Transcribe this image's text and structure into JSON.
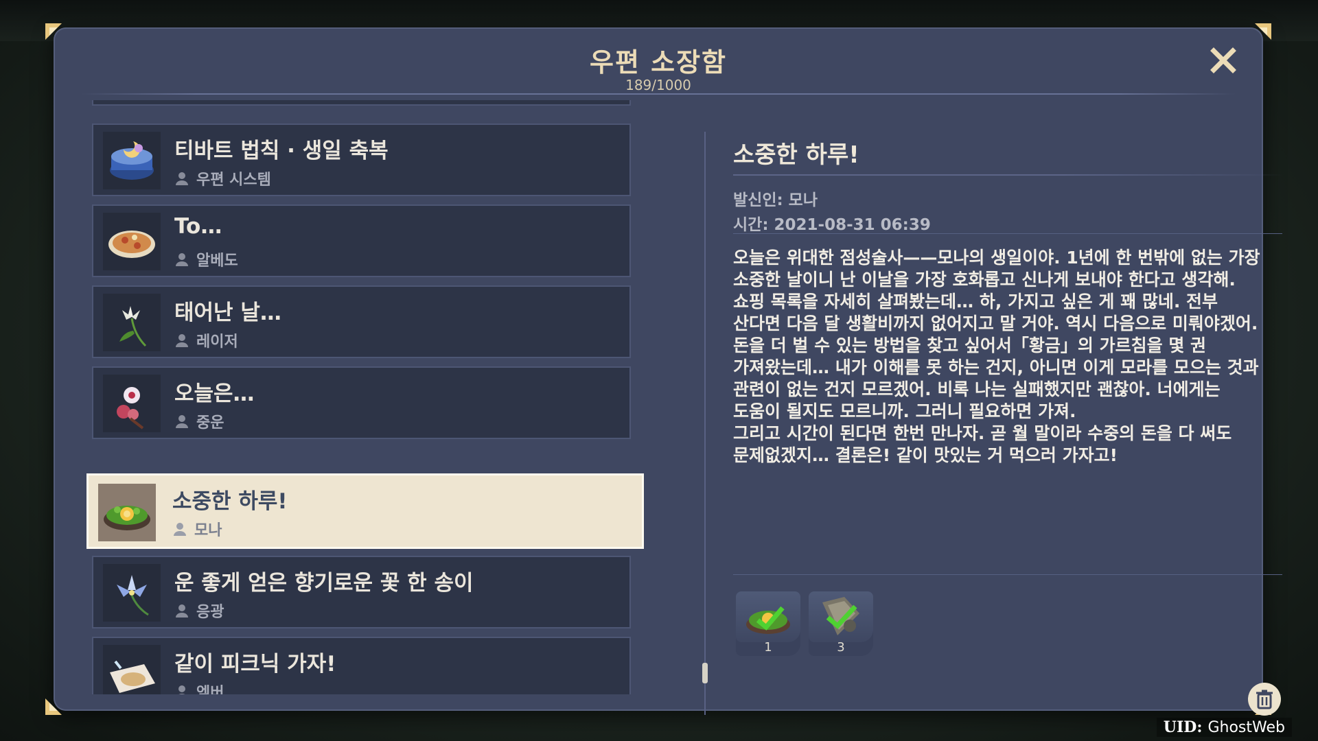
{
  "header": {
    "title": "우편 소장함",
    "count": "189/1000"
  },
  "mails": [
    {
      "subject": "티바트 법칙 · 생일 축복",
      "sender": "우편 시스템",
      "thumb": "cake-icon"
    },
    {
      "subject": "To…",
      "sender": "알베도",
      "thumb": "pizza-icon"
    },
    {
      "subject": "태어난 날…",
      "sender": "레이저",
      "thumb": "lily-icon"
    },
    {
      "subject": "오늘은…",
      "sender": "중운",
      "thumb": "flower-icon"
    },
    {
      "subject": "소중한 하루!",
      "sender": "모나",
      "thumb": "salad-icon",
      "selected": true
    },
    {
      "subject": "운 좋게 얻은 향기로운 꽃 한 송이",
      "sender": "응광",
      "thumb": "glaze-lily-icon"
    },
    {
      "subject": "같이 피크닉 가자!",
      "sender": "엠버",
      "thumb": "bread-icon"
    }
  ],
  "detail": {
    "subject": "소중한 하루!",
    "sender": "발신인: 모나",
    "time": "시간: 2021-08-31 06:39",
    "body": "오늘은 위대한 점성술사——모나의 생일이야. 1년에 한 번밖에 없는 가장\n소중한 날이니 난 이날을 가장 호화롭고 신나게 보내야 한다고 생각해.\n쇼핑 목록을 자세히 살펴봤는데… 하, 가지고 싶은 게 꽤 많네. 전부\n산다면 다음 달 생활비까지 없어지고 말 거야. 역시 다음으로 미뤄야겠어.\n돈을 더 벌 수 있는 방법을 찾고 싶어서「황금」의 가르침을 몇 권\n가져왔는데… 내가 이해를 못 하는 건지, 아니면 이게 모라를 모으는 것과\n관련이 없는 건지 모르겠어. 비록 나는 실패했지만 괜찮아. 너에게는\n도움이 될지도 모르니까. 그러니 필요하면 가져.\n그리고 시간이 된다면 한번 만나자. 곧 월 말이라 수중의 돈을 다 써도\n문제없겠지… 결론은! 같이 맛있는 거 먹으러 가자고!",
    "attachments": [
      {
        "icon": "salad-item-icon",
        "qty": "1",
        "claimed": true
      },
      {
        "icon": "book-item-icon",
        "qty": "3",
        "claimed": true
      }
    ]
  },
  "uid": {
    "label": "UID:",
    "value": "GhostWeb"
  },
  "colors": {
    "panel": "#3f4761",
    "item": "#2d3447",
    "selected": "#eee5d1",
    "gold": "#ecdcb7",
    "check": "#4fd132"
  }
}
